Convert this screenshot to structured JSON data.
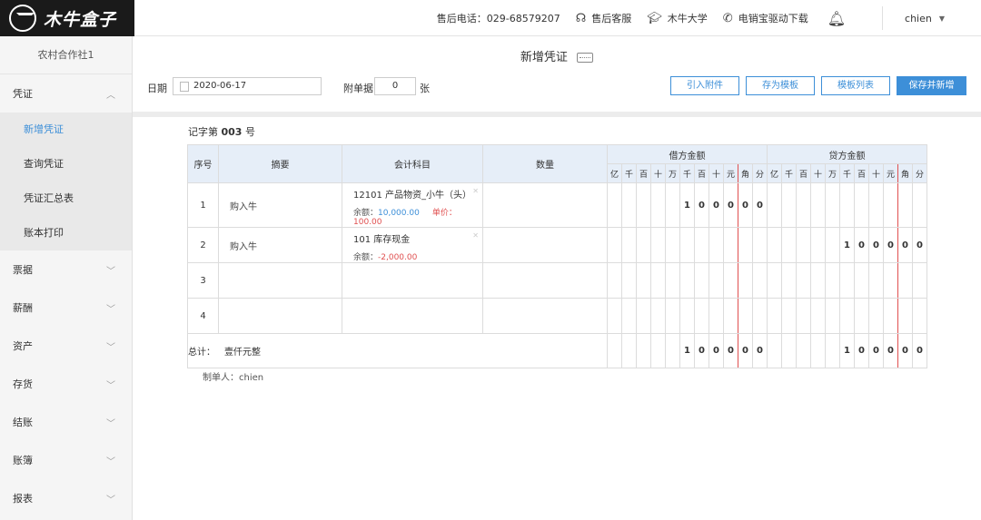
{
  "brand": {
    "name": "木牛盒子"
  },
  "header": {
    "items": [
      {
        "icon": "phone",
        "label": "售后电话：029-68579207"
      },
      {
        "icon": "headset-icon",
        "label": "售后客服"
      },
      {
        "icon": "graduation-cap-icon",
        "label": "木牛大学"
      },
      {
        "icon": "phone-icon",
        "label": "电销宝驱动下载"
      }
    ],
    "user": "chien"
  },
  "sidebar": {
    "org": "农村合作社1",
    "groups": [
      {
        "label": "凭证",
        "expanded": true
      },
      {
        "label": "票据"
      },
      {
        "label": "薪酬"
      },
      {
        "label": "资产"
      },
      {
        "label": "存货"
      },
      {
        "label": "结账"
      },
      {
        "label": "账簿"
      },
      {
        "label": "报表"
      }
    ],
    "sub_items": [
      "新增凭证",
      "查询凭证",
      "凭证汇总表",
      "账本打印"
    ],
    "active": "新增凭证"
  },
  "main": {
    "title": "新增凭证",
    "date_label": "日期",
    "date_value": "2020-06-17",
    "attach_label": "附单据",
    "attach_value": "0",
    "attach_unit": "张",
    "buttons": {
      "import": "引入附件",
      "save_template": "存为模板",
      "template_list": "模板列表",
      "save_new": "保存并新增"
    },
    "voucher_prefix": "记字第",
    "voucher_number": "003",
    "voucher_suffix": "号",
    "maker": "制单人：chien"
  },
  "table": {
    "headers": {
      "seq": "序号",
      "summary": "摘要",
      "account": "会计科目",
      "qty": "数量",
      "debit": "借方金额",
      "credit": "贷方金额"
    },
    "digit_units": [
      "亿",
      "千",
      "百",
      "十",
      "万",
      "千",
      "百",
      "十",
      "元",
      "角",
      "分"
    ],
    "rows": [
      {
        "seq": "1",
        "summary": "购入牛",
        "account": "12101 产品物资_小牛（头）",
        "balance_label": "余额：",
        "balance": "10,000.00",
        "price_label": "单价：",
        "price": "100.00",
        "debit_digits": [
          "",
          "",
          "",
          "",
          "",
          "1",
          "0",
          "0",
          "0",
          "0",
          "0"
        ],
        "credit_digits": [
          "",
          "",
          "",
          "",
          "",
          "",
          "",
          "",
          "",
          "",
          ""
        ]
      },
      {
        "seq": "2",
        "summary": "购入牛",
        "account": "101 库存现金",
        "balance_label": "余额：",
        "balance": "-2,000.00",
        "price_label": "",
        "price": "",
        "debit_digits": [
          "",
          "",
          "",
          "",
          "",
          "",
          "",
          "",
          "",
          "",
          ""
        ],
        "credit_digits": [
          "",
          "",
          "",
          "",
          "",
          "1",
          "0",
          "0",
          "0",
          "0",
          "0"
        ]
      },
      {
        "seq": "3",
        "summary": "",
        "account": "",
        "debit_digits": [
          "",
          "",
          "",
          "",
          "",
          "",
          "",
          "",
          "",
          "",
          ""
        ],
        "credit_digits": [
          "",
          "",
          "",
          "",
          "",
          "",
          "",
          "",
          "",
          "",
          ""
        ]
      },
      {
        "seq": "4",
        "summary": "",
        "account": "",
        "debit_digits": [
          "",
          "",
          "",
          "",
          "",
          "",
          "",
          "",
          "",
          "",
          ""
        ],
        "credit_digits": [
          "",
          "",
          "",
          "",
          "",
          "",
          "",
          "",
          "",
          "",
          ""
        ]
      }
    ],
    "total": {
      "label": "总计：",
      "amount_words": "壹仟元整",
      "debit_digits": [
        "",
        "",
        "",
        "",
        "",
        "1",
        "0",
        "0",
        "0",
        "0",
        "0"
      ],
      "credit_digits": [
        "",
        "",
        "",
        "",
        "",
        "1",
        "0",
        "0",
        "0",
        "0",
        "0"
      ]
    }
  }
}
